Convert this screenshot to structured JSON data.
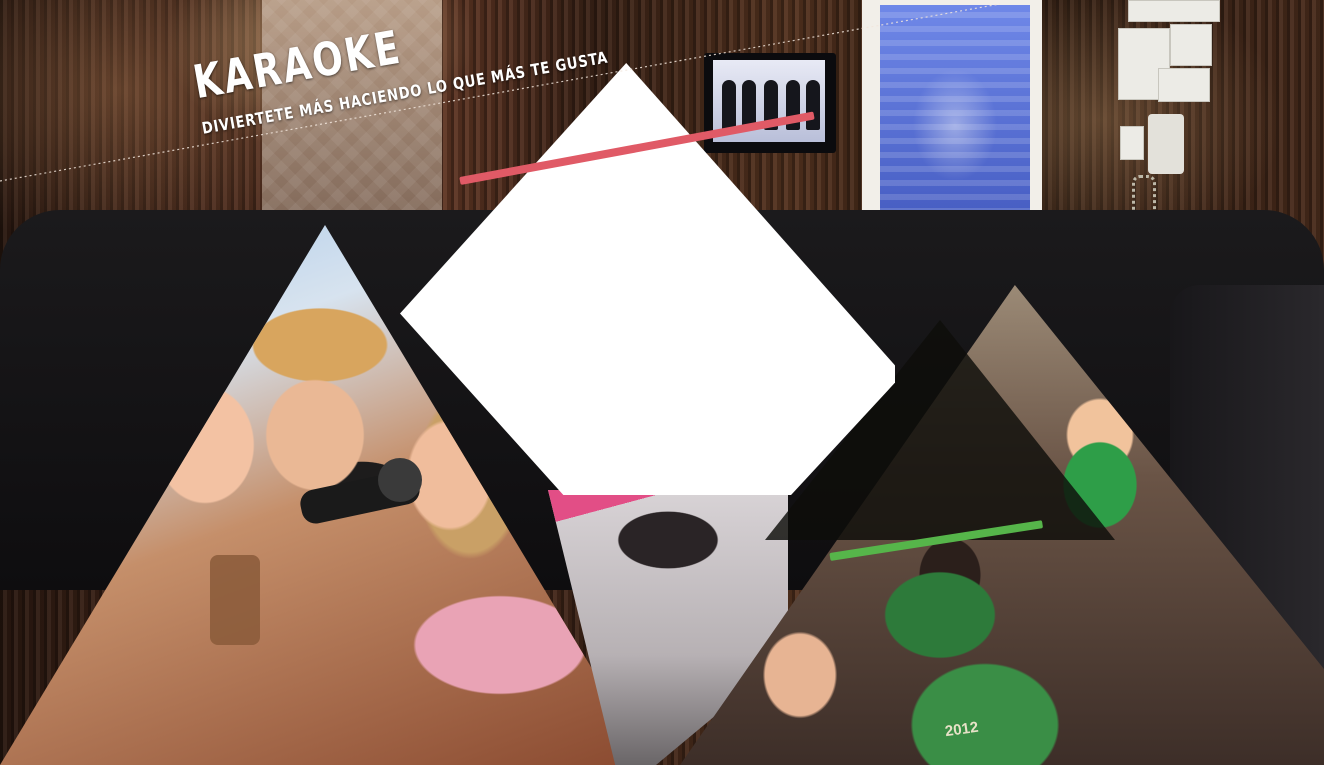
{
  "hero": {
    "title": "KARAOKE",
    "subtitle": "DIVIERTETE MÁS HACIENDO LO QUE MÁS TE GUSTA"
  },
  "shirt_text": "2012",
  "colors": {
    "accent_red": "#e05a66",
    "accent_green": "#56b54a",
    "white_panel": "#ffffff",
    "dark_overlay": "#0e0e0a"
  },
  "icons": [
    "microphone-icon"
  ]
}
